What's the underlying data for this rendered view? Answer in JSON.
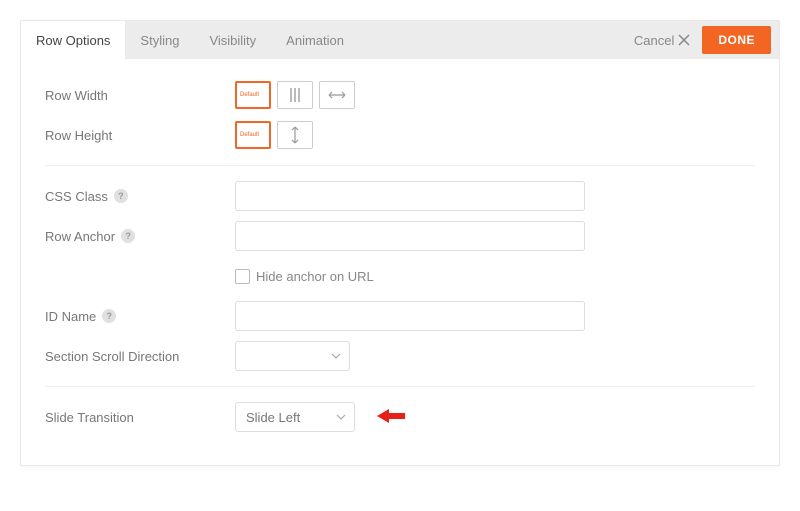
{
  "tabs": {
    "row_options": "Row Options",
    "styling": "Styling",
    "visibility": "Visibility",
    "animation": "Animation"
  },
  "actions": {
    "cancel": "Cancel",
    "done": "DONE"
  },
  "labels": {
    "row_width": "Row Width",
    "row_height": "Row Height",
    "css_class": "CSS Class",
    "row_anchor": "Row Anchor",
    "hide_anchor": "Hide anchor on URL",
    "id_name": "ID Name",
    "section_scroll": "Section Scroll Direction",
    "slide_transition": "Slide Transition"
  },
  "thumb_default": "Default",
  "help_symbol": "?",
  "slide_transition_value": "Slide Left",
  "section_scroll_value": ""
}
